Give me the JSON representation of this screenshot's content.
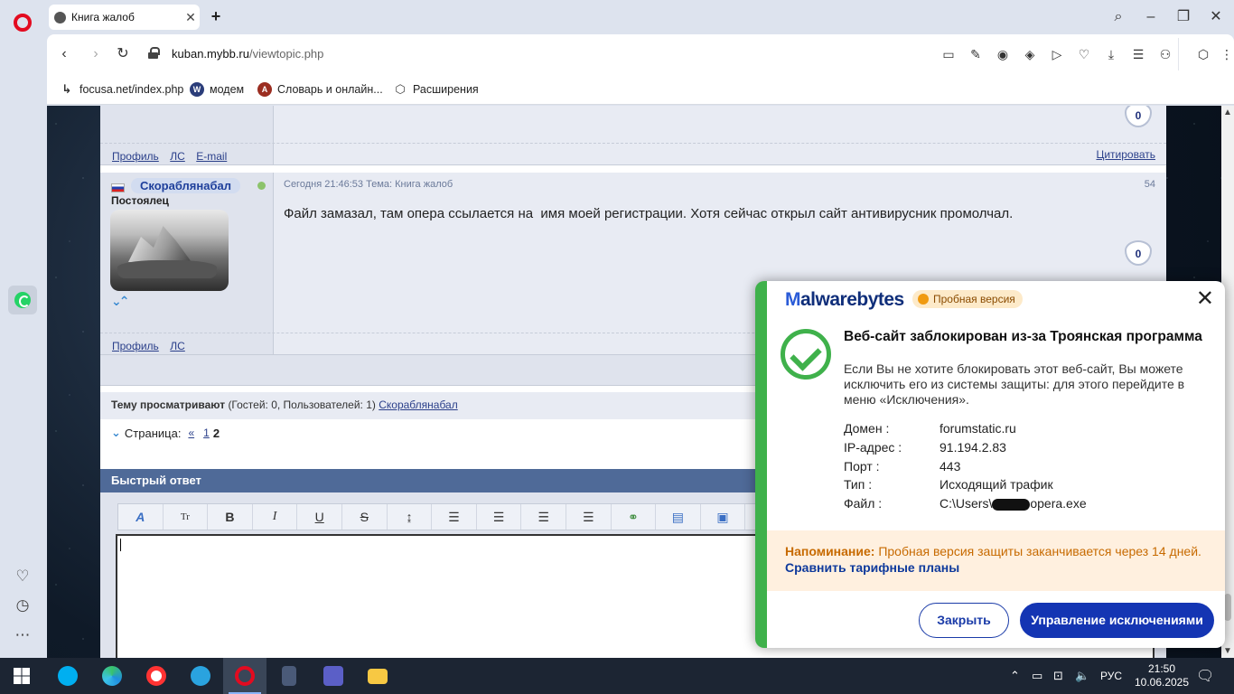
{
  "browser": {
    "tab_title": "Книга жалоб",
    "url_host": "kuban.mybb.ru",
    "url_path": "/viewtopic.php",
    "bookmarks": [
      {
        "label": "focusa.net/index.php"
      },
      {
        "label": "модем"
      },
      {
        "label": "Словарь и онлайн..."
      },
      {
        "label": "Расширения"
      }
    ]
  },
  "forum": {
    "prev_post": {
      "profile": "Профиль",
      "pm": "ЛС",
      "email": "E-mail",
      "quote": "Цитировать",
      "likes": "0"
    },
    "post": {
      "author": "Скораблянабал",
      "rank": "Постоялец",
      "meta_date": "Сегодня 21:46:53",
      "meta_topic_label": "Тема:",
      "meta_topic": "Книга жалоб",
      "number": "54",
      "text": "Файл замазал, там опера ссылается на  имя моей регистрации. Хотя сейчас открыл сайт антивирусник промолчал.",
      "likes": "0",
      "profile": "Профиль",
      "pm": "ЛС"
    },
    "viewers_label": "Тему просматривают",
    "viewers_counts": "(Гостей: 0, Пользователей: 1)",
    "viewers_user": "Скораблянабал",
    "pagination": {
      "label": "Страница:",
      "prev": "«",
      "page1": "1",
      "current": "2"
    },
    "quick_reply_title": "Быстрый ответ"
  },
  "malwarebytes": {
    "brand_prefix": "M",
    "brand": "alwarebytes",
    "trial_badge": "Пробная версия",
    "heading": "Веб-сайт заблокирован из-за Троянская программа",
    "description": "Если Вы не хотите блокировать этот веб-сайт, Вы можете исключить его из системы защиты: для этого перейдите в меню «Исключения».",
    "details": [
      {
        "key": "Домен :",
        "value": "forumstatic.ru"
      },
      {
        "key": "IP-адрес :",
        "value": "91.194.2.83"
      },
      {
        "key": "Порт :",
        "value": "443"
      },
      {
        "key": "Тип :",
        "value": "Исходящий трафик"
      }
    ],
    "file_key": "Файл :",
    "file_prefix": "C:\\Users\\",
    "file_suffix": "opera.exe",
    "reminder_label": "Напоминание:",
    "reminder_text": "Пробная версия защиты заканчивается через 14 дней.",
    "compare_link": "Сравнить тарифные планы",
    "close_button": "Закрыть",
    "manage_button": "Управление исключениями",
    "accent_color": "#3fb14b",
    "brand_color": "#1435b3"
  },
  "taskbar": {
    "lang": "РУС",
    "time": "21:50",
    "date": "10.06.2025"
  }
}
